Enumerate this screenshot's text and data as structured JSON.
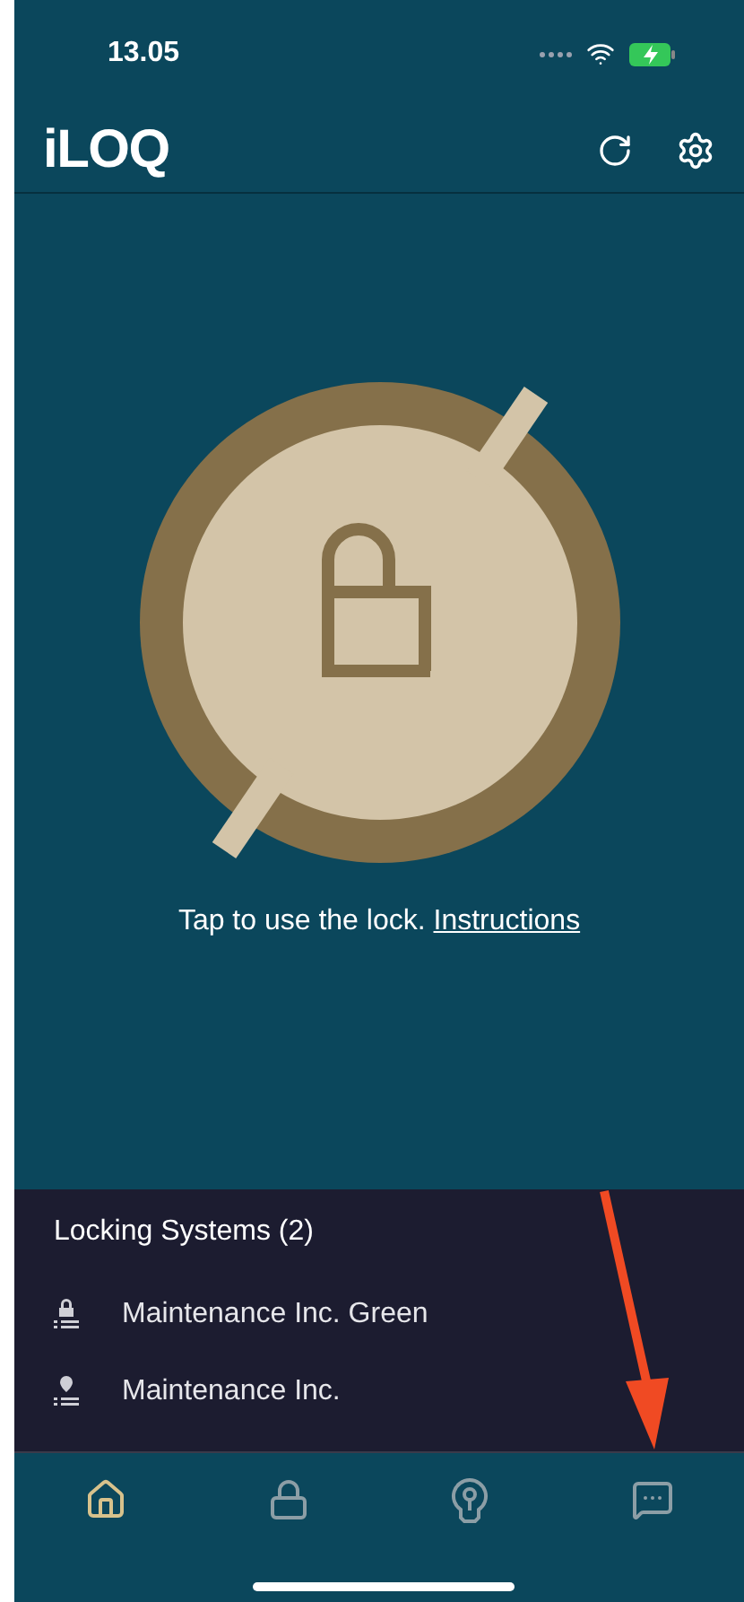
{
  "status_bar": {
    "time": "13.05"
  },
  "header": {
    "logo": "iLOQ"
  },
  "lock": {
    "prompt": "Tap to use the lock.",
    "link": "Instructions"
  },
  "locking_systems": {
    "title": "Locking Systems (2)",
    "items": [
      {
        "name": "Maintenance Inc. Green",
        "kind": "lock"
      },
      {
        "name": "Maintenance Inc.",
        "kind": "pin"
      }
    ]
  },
  "nav": [
    {
      "kind": "home",
      "selected": true
    },
    {
      "kind": "lock",
      "selected": false
    },
    {
      "kind": "key",
      "selected": false
    },
    {
      "kind": "chat",
      "selected": false
    }
  ]
}
